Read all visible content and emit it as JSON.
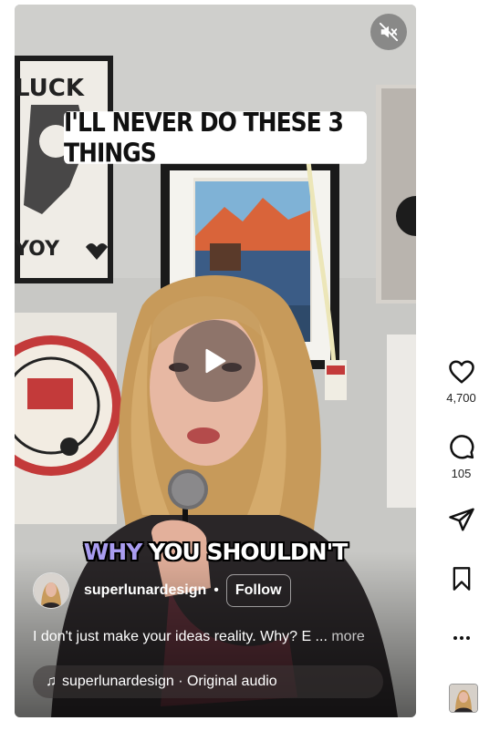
{
  "video": {
    "caption_top": "I'LL NEVER DO THESE 3 THINGS",
    "subtitle_highlight": "WHY",
    "subtitle_rest": " YOU SHOULDN'T",
    "highlight_color": "#a99cf0"
  },
  "author": {
    "username": "superlunardesign",
    "separator": "•",
    "follow_label": "Follow"
  },
  "description": {
    "text": "I don't just make your ideas reality. Why? E",
    "ellipsis": " ... ",
    "more_label": "more"
  },
  "audio": {
    "label": "superlunardesign · Original audio"
  },
  "actions": {
    "likes": "4,700",
    "comments": "105"
  },
  "icons": {
    "mute": "speaker-muted-icon",
    "play": "play-icon",
    "like": "heart-icon",
    "comment": "comment-bubble-icon",
    "share": "paper-plane-icon",
    "save": "bookmark-icon",
    "more": "more-horizontal-icon",
    "music": "music-note-icon"
  }
}
